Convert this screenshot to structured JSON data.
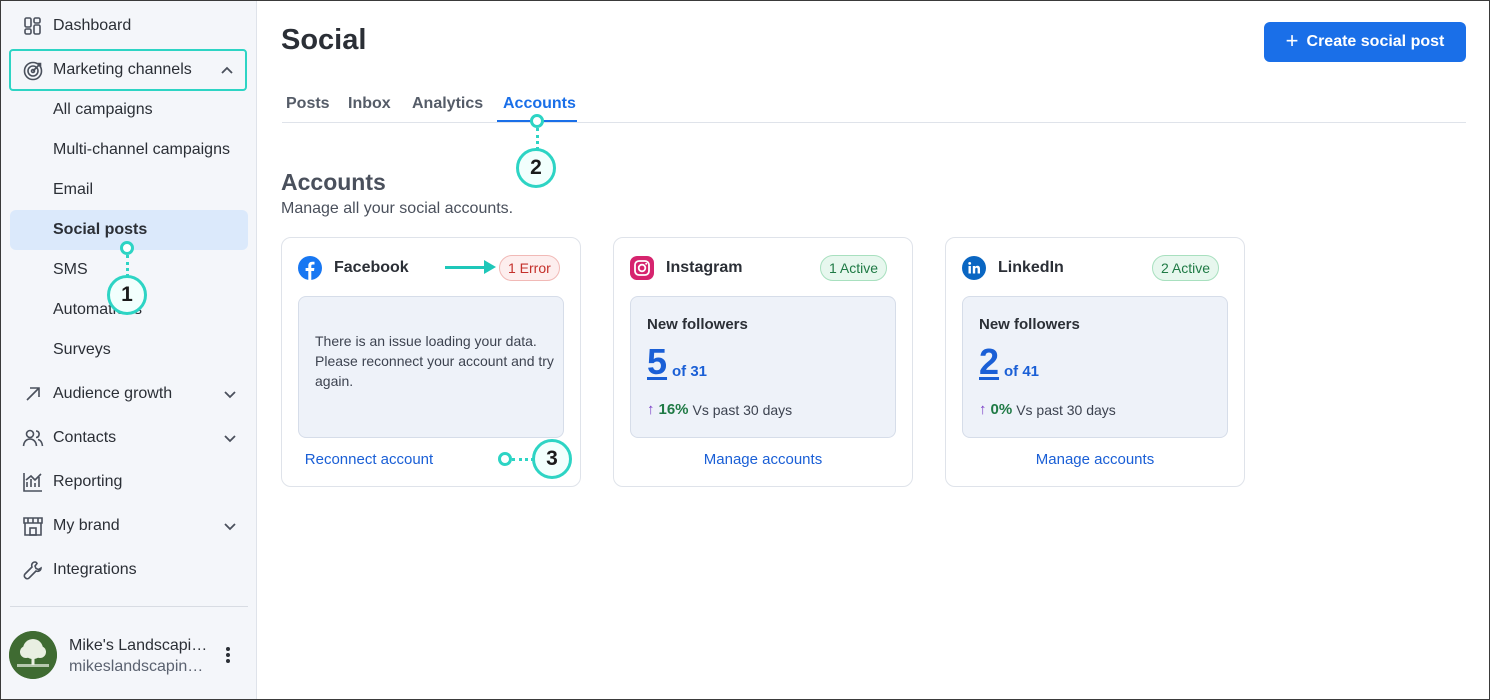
{
  "sidebar": {
    "top_items": [
      {
        "label": "Dashboard",
        "icon": "dashboard-icon"
      },
      {
        "label": "Marketing channels",
        "icon": "target-icon"
      }
    ],
    "sub_items": [
      {
        "label": "All campaigns"
      },
      {
        "label": "Multi-channel campaigns"
      },
      {
        "label": "Email"
      },
      {
        "label": "Social posts"
      },
      {
        "label": "SMS"
      },
      {
        "label": "Automations"
      },
      {
        "label": "Surveys"
      }
    ],
    "bottom_items": [
      {
        "label": "Audience growth",
        "icon": "arrow-up-right-icon"
      },
      {
        "label": "Contacts",
        "icon": "contacts-icon"
      },
      {
        "label": "Reporting",
        "icon": "reporting-icon"
      },
      {
        "label": "My brand",
        "icon": "store-icon"
      },
      {
        "label": "Integrations",
        "icon": "wrench-icon"
      }
    ],
    "profile": {
      "name": "Mike's Landscaping",
      "email": "mikeslandscaping@example.com"
    }
  },
  "header": {
    "title": "Social",
    "create_button": "Create social post"
  },
  "tabs": [
    {
      "label": "Posts"
    },
    {
      "label": "Inbox"
    },
    {
      "label": "Analytics"
    },
    {
      "label": "Accounts"
    }
  ],
  "accounts": {
    "title": "Accounts",
    "subtitle": "Manage all your social accounts.",
    "cards": [
      {
        "name": "Facebook",
        "badge": "1 Error",
        "error_text": "There is an issue loading your data. Please reconnect your account and try again.",
        "link": "Reconnect account"
      },
      {
        "name": "Instagram",
        "badge": "1 Active",
        "stat_label": "New followers",
        "stat_value": "5",
        "stat_of": "of 31",
        "trend_pct": "16%",
        "trend_text": "Vs past 30 days",
        "link": "Manage accounts"
      },
      {
        "name": "LinkedIn",
        "badge": "2 Active",
        "stat_label": "New followers",
        "stat_value": "2",
        "stat_of": "of 41",
        "trend_pct": "0%",
        "trend_text": "Vs past 30 days",
        "link": "Manage accounts"
      }
    ]
  },
  "annotations": [
    "1",
    "2",
    "3"
  ],
  "colors": {
    "accent": "#1a6fe8",
    "callout": "#2dd4c4",
    "error": "#c4302b",
    "active": "#1f7a45"
  }
}
